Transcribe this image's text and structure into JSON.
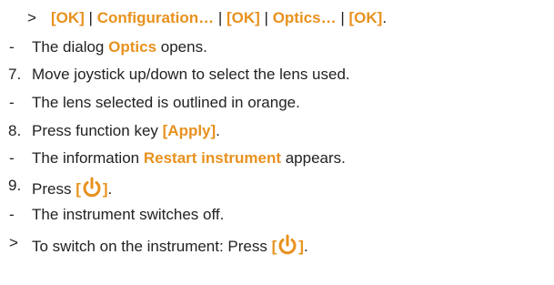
{
  "accent_color": "#e8911e",
  "lines": [
    {
      "marker": ">",
      "parts": [
        {
          "t": "[OK]",
          "hl": true
        },
        {
          "t": " | ",
          "hl": false
        },
        {
          "t": "Configuration…",
          "hl": true
        },
        {
          "t": " | ",
          "hl": false
        },
        {
          "t": "[OK]",
          "hl": true
        },
        {
          "t": " | ",
          "hl": false
        },
        {
          "t": "Optics…",
          "hl": true
        },
        {
          "t": " | ",
          "hl": false
        },
        {
          "t": "[OK]",
          "hl": true
        },
        {
          "t": ".",
          "hl": false
        }
      ]
    },
    {
      "marker": "-",
      "parts": [
        {
          "t": "The dialog ",
          "hl": false
        },
        {
          "t": "Optics",
          "hl": true
        },
        {
          "t": " opens.",
          "hl": false
        }
      ]
    },
    {
      "marker": "7.",
      "parts": [
        {
          "t": "Move joystick up/down to select the lens used.",
          "hl": false
        }
      ]
    },
    {
      "marker": "-",
      "parts": [
        {
          "t": "The lens selected is outlined in orange.",
          "hl": false
        }
      ]
    },
    {
      "marker": "8.",
      "parts": [
        {
          "t": "Press function key ",
          "hl": false
        },
        {
          "t": "[Apply]",
          "hl": true
        },
        {
          "t": ".",
          "hl": false
        }
      ]
    },
    {
      "marker": "-",
      "parts": [
        {
          "t": "The information ",
          "hl": false
        },
        {
          "t": "Restart instrument",
          "hl": true
        },
        {
          "t": " appears.",
          "hl": false
        }
      ]
    },
    {
      "marker": "9.",
      "parts": [
        {
          "t": "Press ",
          "hl": false
        },
        {
          "t": "[",
          "hl": true
        },
        {
          "icon": "power-icon"
        },
        {
          "t": "]",
          "hl": true
        },
        {
          "t": ".",
          "hl": false
        }
      ]
    },
    {
      "marker": "-",
      "parts": [
        {
          "t": "The instrument switches off.",
          "hl": false
        }
      ]
    },
    {
      "marker": ">",
      "parts": [
        {
          "t": "To switch on the instrument: Press ",
          "hl": false
        },
        {
          "t": "[",
          "hl": true
        },
        {
          "icon": "power-icon"
        },
        {
          "t": "]",
          "hl": true
        },
        {
          "t": ".",
          "hl": false
        }
      ]
    }
  ]
}
